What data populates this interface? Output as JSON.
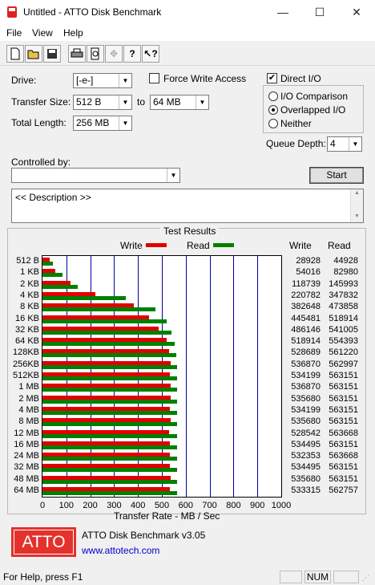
{
  "window": {
    "title": "Untitled - ATTO Disk Benchmark",
    "minimize": "—",
    "maximize": "☐",
    "close": "✕"
  },
  "menu": [
    {
      "label": "File"
    },
    {
      "label": "View"
    },
    {
      "label": "Help"
    }
  ],
  "toolbar": {
    "icons": [
      "new-icon",
      "open-icon",
      "save-icon",
      "print-icon",
      "print-preview-icon",
      "move-icon",
      "help-icon",
      "context-help-icon"
    ]
  },
  "form": {
    "drive_label": "Drive:",
    "drive_value": "[-e-]",
    "transfer_size_label": "Transfer Size:",
    "transfer_from": "512 B",
    "to_label": "to",
    "transfer_to": "64 MB",
    "total_length_label": "Total Length:",
    "total_length": "256 MB",
    "force_write_label": "Force Write Access",
    "force_write_checked": false,
    "direct_io_label": "Direct I/O",
    "direct_io_checked": true,
    "io_comparison_label": "I/O Comparison",
    "overlapped_io_label": "Overlapped I/O",
    "neither_label": "Neither",
    "selected_mode": "Overlapped I/O",
    "queue_depth_label": "Queue Depth:",
    "queue_depth": "4",
    "controlled_by_label": "Controlled by:",
    "controlled_by_value": "",
    "start_label": "Start",
    "description": "<< Description >>"
  },
  "results": {
    "group_title": "Test Results",
    "write_col": "Write",
    "read_col": "Read"
  },
  "chart_data": {
    "type": "bar",
    "orientation": "horizontal",
    "legend": [
      "Write",
      "Read"
    ],
    "colors": {
      "write": "#e00000",
      "read": "#008000"
    },
    "categories": [
      "512 B",
      "1 KB",
      "2 KB",
      "4 KB",
      "8 KB",
      "16 KB",
      "32 KB",
      "64 KB",
      "128KB",
      "256KB",
      "512KB",
      "1 MB",
      "2 MB",
      "4 MB",
      "8 MB",
      "12 MB",
      "16 MB",
      "24 MB",
      "32 MB",
      "48 MB",
      "64 MB"
    ],
    "write_display": [
      "28928",
      "54016",
      "118739",
      "220782",
      "382648",
      "445481",
      "486146",
      "518914",
      "528689",
      "536870",
      "534199",
      "536870",
      "535680",
      "534199",
      "535680",
      "528542",
      "534495",
      "532353",
      "534495",
      "535680",
      "533315"
    ],
    "read_display": [
      "44928",
      "82980",
      "145993",
      "347832",
      "473858",
      "518914",
      "541005",
      "554393",
      "561220",
      "562997",
      "563151",
      "563151",
      "563151",
      "563151",
      "563151",
      "563668",
      "563151",
      "563668",
      "563151",
      "563151",
      "562757"
    ],
    "series": [
      {
        "name": "Write",
        "values": [
          28.928,
          54.016,
          118.739,
          220.782,
          382.648,
          445.481,
          486.146,
          518.914,
          528.689,
          536.87,
          534.199,
          536.87,
          535.68,
          534.199,
          535.68,
          528.542,
          534.495,
          532.353,
          534.495,
          535.68,
          533.315
        ]
      },
      {
        "name": "Read",
        "values": [
          44.928,
          82.98,
          145.993,
          347.832,
          473.858,
          518.914,
          541.005,
          554.393,
          561.22,
          562.997,
          563.151,
          563.151,
          563.151,
          563.151,
          563.151,
          563.668,
          563.151,
          563.668,
          563.151,
          563.151,
          562.757
        ]
      }
    ],
    "xlabel": "Transfer Rate - MB / Sec",
    "xticks": [
      "0",
      "100",
      "200",
      "300",
      "400",
      "500",
      "600",
      "700",
      "800",
      "900",
      "1000"
    ],
    "xlim": [
      0,
      1000
    ]
  },
  "footer": {
    "logo": "ATTO",
    "product": "ATTO Disk Benchmark v3.05",
    "url": "www.attotech.com"
  },
  "statusbar": {
    "help_text": "For Help, press F1",
    "num": "NUM"
  }
}
